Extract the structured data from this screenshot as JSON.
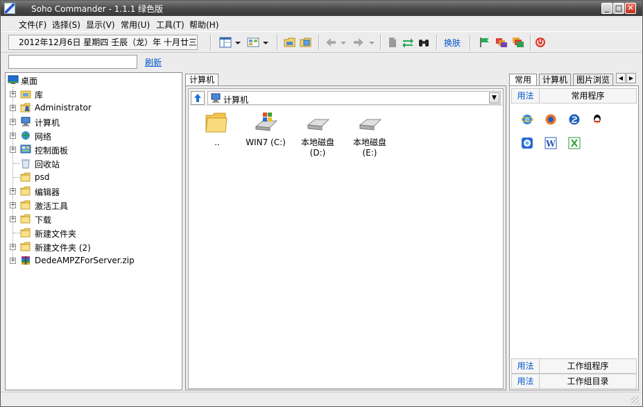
{
  "window": {
    "title": "Soho Commander - 1.1.1 绿色版",
    "controls": {
      "minimize": "_",
      "maximize": "□",
      "close": "✕"
    }
  },
  "menu": [
    {
      "label": "文件(F)"
    },
    {
      "label": "选择(S)"
    },
    {
      "label": "显示(V)"
    },
    {
      "label": "常用(U)"
    },
    {
      "label": "工具(T)"
    },
    {
      "label": "帮助(H)"
    }
  ],
  "toolbar": {
    "date_text": "2012年12月6日  星期四  壬辰（龙）年  十月廿三",
    "skin_label": "换肤"
  },
  "address": {
    "value": "",
    "refresh_label": "刷新"
  },
  "tree": {
    "root_label": "桌面",
    "items": [
      {
        "label": "库",
        "icon": "library-icon",
        "expandable": true
      },
      {
        "label": "Administrator",
        "icon": "user-folder-icon",
        "expandable": true
      },
      {
        "label": "计算机",
        "icon": "computer-icon",
        "expandable": true
      },
      {
        "label": "网络",
        "icon": "network-icon",
        "expandable": true
      },
      {
        "label": "控制面板",
        "icon": "control-panel-icon",
        "expandable": true
      },
      {
        "label": "回收站",
        "icon": "recycle-bin-icon",
        "expandable": false
      },
      {
        "label": "psd",
        "icon": "folder-icon",
        "expandable": false
      },
      {
        "label": "编辑器",
        "icon": "folder-icon",
        "expandable": true
      },
      {
        "label": "激活工具",
        "icon": "folder-icon",
        "expandable": true
      },
      {
        "label": "下载",
        "icon": "folder-icon",
        "expandable": true
      },
      {
        "label": "新建文件夹",
        "icon": "folder-icon",
        "expandable": false
      },
      {
        "label": "新建文件夹 (2)",
        "icon": "folder-icon",
        "expandable": true
      },
      {
        "label": "DedeAMPZForServer.zip",
        "icon": "zip-archive-icon",
        "expandable": true
      }
    ]
  },
  "center": {
    "tab_label": "计算机",
    "path": "计算机",
    "files": [
      {
        "label": "..",
        "icon": "folder-icon"
      },
      {
        "label": "WIN7 (C:)",
        "icon": "windows-drive-icon"
      },
      {
        "label": "本地磁盘 (D:)",
        "icon": "hard-disk-icon"
      },
      {
        "label": "本地磁盘 (E:)",
        "icon": "hard-disk-icon"
      }
    ]
  },
  "right": {
    "tabs": [
      "常用",
      "计算机",
      "图片浏览"
    ],
    "sections": {
      "common": {
        "use_label": "用法",
        "title": "常用程序"
      },
      "workgroup_programs": {
        "use_label": "用法",
        "title": "工作组程序"
      },
      "workgroup_dirs": {
        "use_label": "用法",
        "title": "工作组目录"
      }
    },
    "apps": [
      {
        "icon": "internet-explorer-icon"
      },
      {
        "icon": "firefox-icon"
      },
      {
        "icon": "sogou-browser-icon"
      },
      {
        "icon": "qq-icon"
      },
      {
        "icon": "media-player-icon"
      },
      {
        "icon": "word-icon"
      },
      {
        "icon": "excel-icon"
      }
    ]
  }
}
